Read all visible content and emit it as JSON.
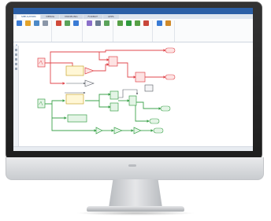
{
  "window": {
    "title": ""
  },
  "tabs": [
    {
      "label": "SIMULATION"
    },
    {
      "label": "DEBUG"
    },
    {
      "label": "MODELING"
    },
    {
      "label": "FORMAT"
    },
    {
      "label": "APPS"
    }
  ],
  "active_tab": 0,
  "ribbon": {
    "groups": [
      {
        "buttons": [
          {
            "icon": "new-icon",
            "color": "#3a7bd5"
          },
          {
            "icon": "open-icon",
            "color": "#e3a32b"
          },
          {
            "icon": "save-icon",
            "color": "#4c89c7"
          },
          {
            "icon": "print-icon",
            "color": "#8a96a8"
          }
        ]
      },
      {
        "buttons": [
          {
            "icon": "library-icon",
            "color": "#d04a3a"
          },
          {
            "icon": "log-signals-icon",
            "color": "#5aa35a"
          },
          {
            "icon": "add-viewer-icon",
            "color": "#3a7bd5"
          }
        ]
      },
      {
        "buttons": [
          {
            "icon": "signal-table-icon",
            "color": "#8a6fc9"
          },
          {
            "icon": "stop-time-icon",
            "color": "#6b7c93"
          },
          {
            "icon": "normal-mode-icon",
            "color": "#5aa35a"
          }
        ]
      },
      {
        "buttons": [
          {
            "icon": "step-back-icon",
            "color": "#56a046"
          },
          {
            "icon": "run-icon",
            "color": "#2f9a3f"
          },
          {
            "icon": "step-forward-icon",
            "color": "#56a046"
          },
          {
            "icon": "stop-icon",
            "color": "#c9473b"
          }
        ]
      },
      {
        "buttons": [
          {
            "icon": "data-inspector-icon",
            "color": "#3a7bd5"
          },
          {
            "icon": "logic-analyzer-icon",
            "color": "#d08a2a"
          }
        ]
      }
    ]
  },
  "address": {
    "crumbs": []
  },
  "status": {
    "left": "",
    "right": ""
  },
  "colors": {
    "title_bar": "#2b5fa6",
    "line_red": "#e0474c",
    "line_green": "#3ea34d",
    "line_dark": "#555a62"
  }
}
